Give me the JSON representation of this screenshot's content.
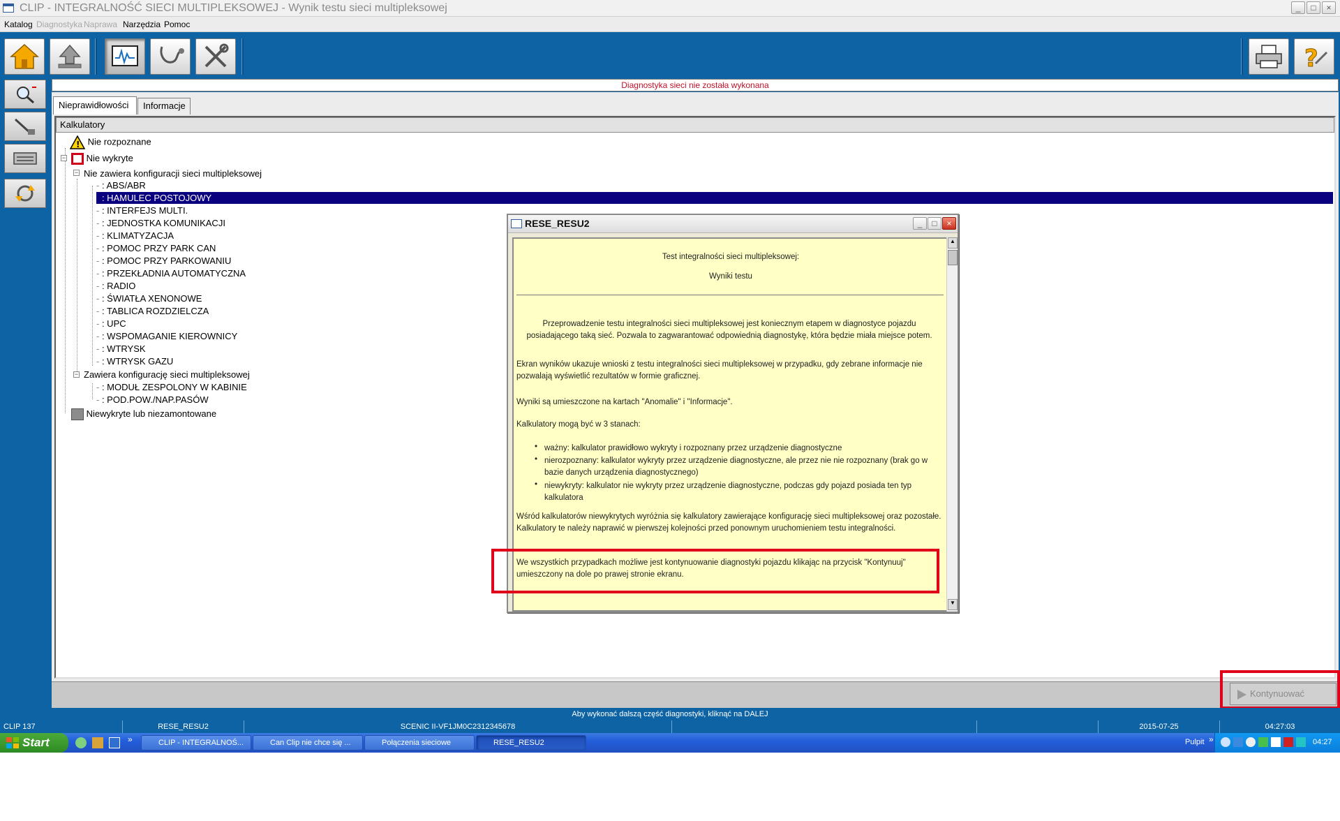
{
  "window": {
    "title": "CLIP - INTEGRALNOŚĆ SIECI MULTIPLEKSOWEJ - Wynik testu sieci multipleksowej"
  },
  "menu": {
    "items": [
      {
        "label": "Katalog",
        "enabled": true
      },
      {
        "label": "Diagnostyka",
        "enabled": false
      },
      {
        "label": "Naprawa",
        "enabled": false
      },
      {
        "label": "Narzędzia",
        "enabled": true
      },
      {
        "label": "Pomoc",
        "enabled": true
      }
    ]
  },
  "status_message": "Diagnostyka sieci nie została wykonana",
  "tabs": [
    "Nieprawidłowości",
    "Informacje"
  ],
  "tree": {
    "header": "Kalkulatory",
    "not_recognized": "Nie rozpoznane",
    "not_detected": "Nie wykryte",
    "group1": "Nie zawiera konfiguracji sieci multipleksowej",
    "group1_items": [
      ": ABS/ABR",
      ": HAMULEC POSTOJOWY",
      ": INTERFEJS MULTI.",
      ": JEDNOSTKA KOMUNIKACJI",
      ": KLIMATYZACJA",
      ": POMOC PRZY PARK CAN",
      ": POMOC PRZY PARKOWANIU",
      ": PRZEKŁADNIA AUTOMATYCZNA",
      ": RADIO",
      ": ŚWIATŁA XENONOWE",
      ": TABLICA ROZDZIELCZA",
      ": UPC",
      ": WSPOMAGANIE KIEROWNICY",
      ": WTRYSK",
      ": WTRYSK GAZU"
    ],
    "group2": "Zawiera konfigurację sieci multipleksowej",
    "group2_items": [
      ": MODUŁ ZESPOLONY W KABINIE",
      ": POD.POW./NAP.PASÓW"
    ],
    "not_detected_or_not_mounted": "Niewykryte lub niezamontowane"
  },
  "dialog": {
    "title": "RESE_RESU2",
    "heading1": "Test integralności sieci multipleksowej:",
    "heading2": "Wyniki testu",
    "para1": "Przeprowadzenie testu integralności sieci multipleksowej jest koniecznym etapem w diagnostyce pojazdu posiadającego taką sieć. Pozwala to zagwarantować odpowiednią diagnostykę, która będzie miała miejsce potem.",
    "para2": "Ekran wyników ukazuje wnioski z testu integralności sieci multipleksowej w przypadku, gdy zebrane informacje nie pozwalają wyświetlić rezultatów w formie graficznej.",
    "para3": "Wyniki są umieszczone na kartach \"Anomalie\" i \"Informacje\".",
    "para4": "Kalkulatory mogą być w 3 stanach:",
    "bullet1": "ważny: kalkulator prawidłowo wykryty i rozpoznany przez urządzenie diagnostyczne",
    "bullet2": "nierozpoznany: kalkulator wykryty przez urządzenie diagnostyczne, ale przez nie nie rozpoznany (brak go w bazie danych urządzenia diagnostycznego)",
    "bullet3": "niewykryty: kalkulator nie wykryty przez urządzenie diagnostyczne, podczas gdy pojazd posiada ten typ kalkulatora",
    "para5": "Wśród kalkulatorów niewykrytych wyróżnia się kalkulatory zawierające konfigurację sieci multipleksowej oraz pozostałe. Kalkulatory te należy naprawić w pierwszej kolejności przed ponownym uruchomieniem testu integralności.",
    "para6": "We wszystkich przypadkach możliwe jest kontynuowanie diagnostyki pojazdu klikając na przycisk \"Kontynuuj\" umieszczony na dole po prawej stronie ekranu."
  },
  "continue_button": "Kontynuować",
  "hint": "Aby wykonać dalszą część diagnostyki, kliknąć na DALEJ",
  "statusbar": [
    "CLIP 137",
    "RESE_RESU2",
    "SCENIC II-VF1JM0C2312345678",
    "",
    "",
    "2015-07-25",
    "04:27:03"
  ],
  "taskbar": {
    "start": "Start",
    "tasks": [
      "CLIP - INTEGRALNOŚ...",
      "Can Clip nie chce się ...",
      "Połączenia sieciowe",
      "RESE_RESU2"
    ],
    "desktop": "Pulpit",
    "clock": "04:27"
  },
  "colors": {
    "accent_blue": "#0d63a3",
    "selection": "#0a007f",
    "alert_red": "#e0001a",
    "dialog_bg": "#ffffc6"
  }
}
